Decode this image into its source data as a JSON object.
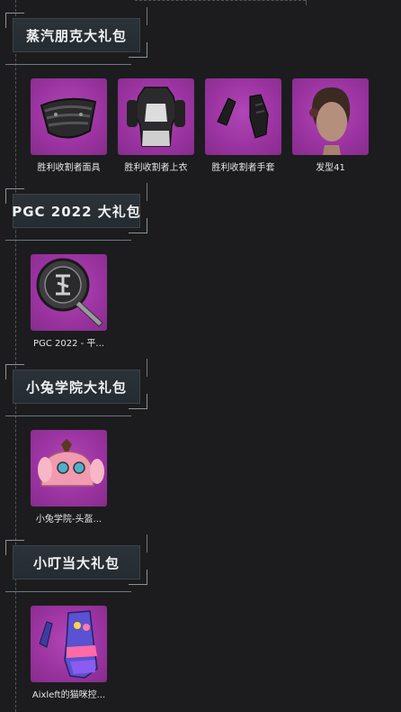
{
  "sections": [
    {
      "title": "蒸汽朋克大礼包",
      "items": [
        {
          "name": "胜利收割者面具",
          "icon": "mask-icon"
        },
        {
          "name": "胜利收割者上衣",
          "icon": "armor-top-icon"
        },
        {
          "name": "胜利收割者手套",
          "icon": "gloves-icon"
        },
        {
          "name": "发型41",
          "icon": "hairstyle-icon"
        }
      ]
    },
    {
      "title": "PGC 2022 大礼包",
      "items": [
        {
          "name": "PGC 2022 - 平...",
          "icon": "pan-icon"
        }
      ]
    },
    {
      "title": "小兔学院大礼包",
      "items": [
        {
          "name": "小兔学院-头盔...",
          "icon": "bunny-helmet-icon"
        }
      ]
    },
    {
      "title": "小叮当大礼包",
      "items": [
        {
          "name": "Aixleft的猫咪控...",
          "icon": "cat-glove-icon"
        }
      ]
    }
  ],
  "colors": {
    "background": "#1c1c1e",
    "item_background": "#9a33a0",
    "text": "#e6e6e6"
  }
}
